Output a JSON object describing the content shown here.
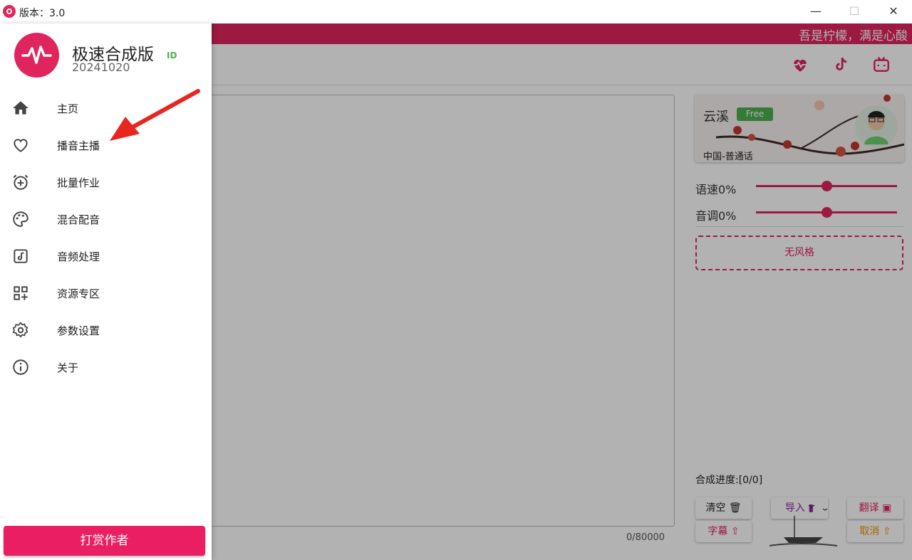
{
  "window": {
    "version": "版本：3.0",
    "minimize": "—",
    "maximize": "☐",
    "close": "✕"
  },
  "header": {
    "slogan": "吾是柠檬，满是心酸",
    "icons": [
      "heart-pulse-icon",
      "tiktok-icon",
      "bilibili-icon"
    ]
  },
  "drawer": {
    "app_name": "极速合成版",
    "build": "20241020",
    "badge": "ID",
    "items": [
      {
        "label": "主页",
        "icon": "home-icon"
      },
      {
        "label": "播音主播",
        "icon": "heart-icon"
      },
      {
        "label": "批量作业",
        "icon": "alarm-add-icon"
      },
      {
        "label": "混合配音",
        "icon": "palette-icon"
      },
      {
        "label": "音频处理",
        "icon": "music-note-icon"
      },
      {
        "label": "资源专区",
        "icon": "grid-plus-icon"
      },
      {
        "label": "参数设置",
        "icon": "gear-icon"
      },
      {
        "label": "关于",
        "icon": "info-icon"
      }
    ],
    "reward_button": "打赏作者"
  },
  "editor": {
    "char_count": "0/80000"
  },
  "voice": {
    "name": "云溪",
    "badge": "Free",
    "language": "中国-普通话"
  },
  "sliders": {
    "speed_label": "语速0%",
    "speed": 0.5,
    "pitch_label": "音调0%",
    "pitch": 0.5
  },
  "style": {
    "label": "无风格"
  },
  "progress": {
    "label": "合成进度:[0/0]"
  },
  "actions": {
    "clear": "清空",
    "import": "导入",
    "translate": "翻译",
    "subtitle": "字幕",
    "cancel": "取消"
  },
  "colors": {
    "accent": "#e0245e",
    "free_badge": "#4caf50",
    "reward": "#e91e63",
    "import": "#8e24aa",
    "cancel": "#ef8f00"
  }
}
